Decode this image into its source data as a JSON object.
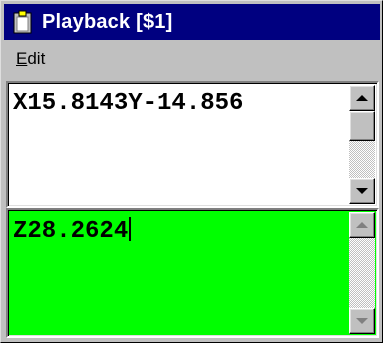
{
  "window": {
    "title": "Playback [$1]",
    "title_icon": "clipboard-icon",
    "titlebar_color": "#000080"
  },
  "menu": {
    "items": [
      {
        "label_first": "E",
        "label_rest": "dit"
      }
    ]
  },
  "panes": {
    "top": {
      "text": "X15.8143Y-14.856",
      "background": "#ffffff"
    },
    "bottom": {
      "text": "Z28.2624",
      "background": "#00ff00"
    }
  }
}
